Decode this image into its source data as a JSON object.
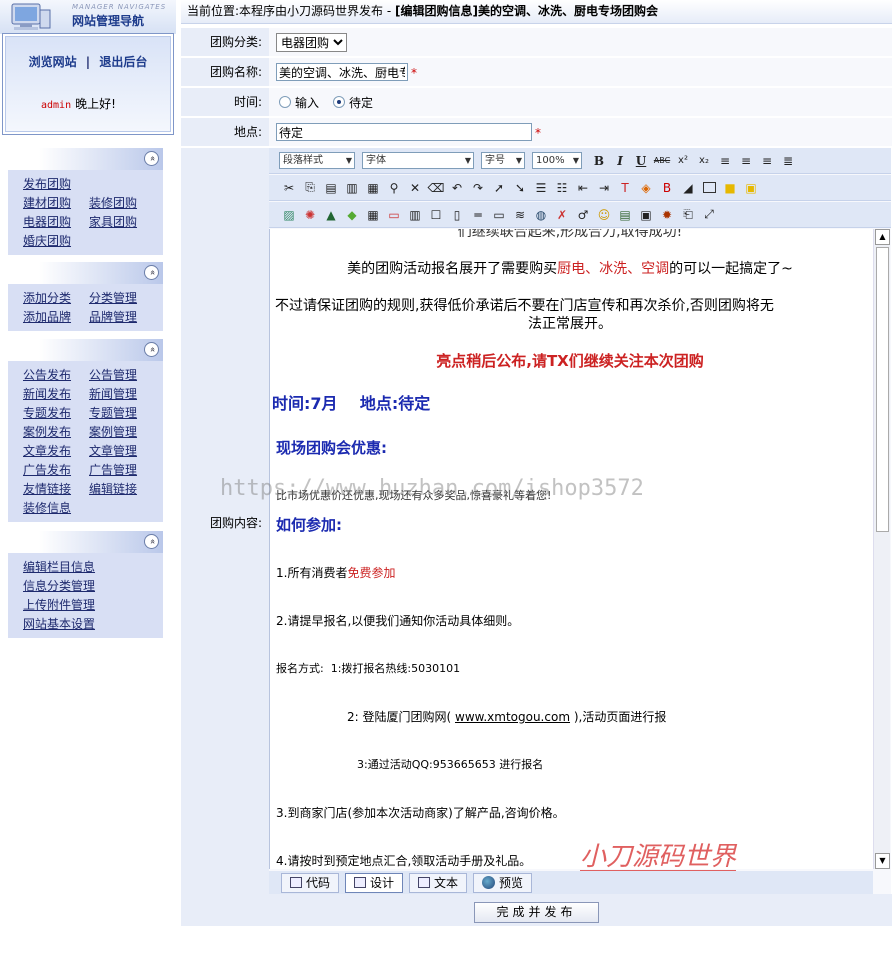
{
  "nav": {
    "subtitle": "MANAGER NAVIGATES",
    "title": "网站管理导航",
    "browse_link": "浏览网站",
    "divider": "|",
    "logout_link": "退出后台",
    "user": "admin",
    "greeting": "晚上好!",
    "collapse_symbol": "«",
    "groups": [
      {
        "items": [
          [
            "发布团购"
          ],
          [
            "建材团购",
            "装修团购"
          ],
          [
            "电器团购",
            "家具团购"
          ],
          [
            "婚庆团购"
          ]
        ]
      },
      {
        "items": [
          [
            "添加分类",
            "分类管理"
          ],
          [
            "添加品牌",
            "品牌管理"
          ]
        ]
      },
      {
        "items": [
          [
            "公告发布",
            "公告管理"
          ],
          [
            "新闻发布",
            "新闻管理"
          ],
          [
            "专题发布",
            "专题管理"
          ],
          [
            "案例发布",
            "案例管理"
          ],
          [
            "文章发布",
            "文章管理"
          ],
          [
            "广告发布",
            "广告管理"
          ],
          [
            "友情链接",
            "编辑链接"
          ],
          [
            "装修信息"
          ]
        ]
      },
      {
        "items": [
          [
            "编辑栏目信息"
          ],
          [
            "信息分类管理"
          ],
          [
            "上传附件管理"
          ],
          [
            "网站基本设置"
          ]
        ]
      }
    ]
  },
  "breadcrumb": {
    "prefix": "当前位置:本程序由小刀源码世界发布 - ",
    "current": "[编辑团购信息]美的空调、冰洗、厨电专场团购会"
  },
  "form": {
    "category_label": "团购分类:",
    "category_value": "电器团购",
    "name_label": "团购名称:",
    "name_value": "美的空调、冰洗、厨电专",
    "required_mark": "*",
    "time_label": "时间:",
    "time_options": [
      "输入",
      "待定"
    ],
    "time_selected": "待定",
    "place_label": "地点:",
    "place_value": "待定",
    "content_label": "团购内容:",
    "submit_label": "完成并发布"
  },
  "editor": {
    "style_select": "段落样式",
    "font_select": "字体",
    "size_select": "字号",
    "zoom_select": "100%",
    "bold": "B",
    "italic": "I",
    "underline": "U",
    "strike": "ABC",
    "superscript": "x²",
    "subscript": "x₂",
    "modes": [
      "代码",
      "设计",
      "文本",
      "预览"
    ],
    "active_mode": "设计",
    "scroll_up": "▲",
    "scroll_down": "▼"
  },
  "content": {
    "cut_line": "们继续联合起来,形成合力,取得成功!",
    "p1_pre": "美的团购活动报名展开了需要购买",
    "p1_red": "厨电、冰洗、空调",
    "p1_post": "的可以一起搞定了~",
    "p2": "不过请保证团购的规则,获得低价承诺后不要在门店宣传和再次杀价,否则团购将无",
    "p2b": "法正常展开。",
    "p3": "亮点稍后公布,请TX们继续关注本次团购",
    "p4": "时间:7月    地点:待定",
    "h_offer": "现场团购会优惠:",
    "offer_text": "比市场优惠价还优惠,现场还有众多奖品,惊喜豪礼等着您!",
    "h_join": "如何参加:",
    "s1_pre": "1.所有消费者",
    "s1_red": "免费参加",
    "s2": "2.请提早报名,以便我们通知你活动具体细则。",
    "s3": "报名方式:  1:拨打报名热线:5030101",
    "s4_pre": "2: 登陆厦门团购网( ",
    "s4_link": "www.xmtogou.com",
    "s4_post": " ),活动页面进行报",
    "s5": "3:通过活动QQ:953665653 进行报名",
    "s6": "3.到商家门店(参加本次活动商家)了解产品,咨询价格。",
    "s7": "4.请按时到预定地点汇合,领取活动手册及礼品。"
  },
  "watermarks": {
    "url": "https://www.huzhan.com/ishop3572",
    "brand": "小刀源码世界"
  },
  "colors": {
    "accent_red": "#cc2222",
    "heading_blue": "#1b2ab0",
    "nav_bg": "#d8dff4"
  }
}
